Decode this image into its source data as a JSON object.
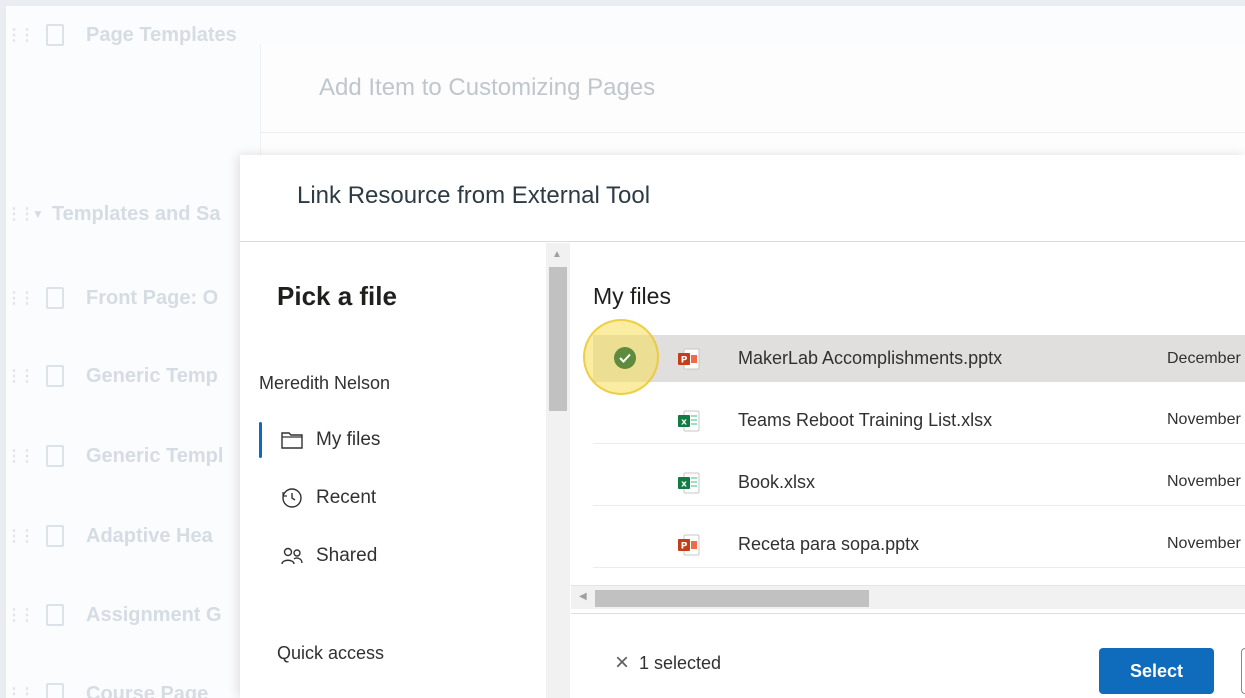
{
  "background": {
    "rows": [
      {
        "label": "Page Templates",
        "kind": "doc"
      },
      {
        "label": "Templates and Sa",
        "kind": "group"
      },
      {
        "label": "Front Page: O",
        "kind": "doc"
      },
      {
        "label": "Generic Temp",
        "kind": "doc"
      },
      {
        "label": "Generic Templ",
        "kind": "doc"
      },
      {
        "label": "Adaptive Hea",
        "kind": "doc"
      },
      {
        "label": "Assignment G",
        "kind": "doc"
      },
      {
        "label": "Course Page",
        "kind": "doc"
      }
    ]
  },
  "middle_modal": {
    "title": "Add Item to Customizing Pages"
  },
  "front_modal": {
    "title": "Link Resource from External Tool"
  },
  "picker": {
    "title": "Pick a file",
    "user": "Meredith Nelson",
    "nav": [
      {
        "label": "My files",
        "icon": "folder-icon",
        "active": true
      },
      {
        "label": "Recent",
        "icon": "history-icon",
        "active": false
      },
      {
        "label": "Shared",
        "icon": "people-icon",
        "active": false
      }
    ],
    "quick_access": "Quick access"
  },
  "files": {
    "title": "My files",
    "rows": [
      {
        "name": "MakerLab Accomplishments.pptx",
        "date": "December",
        "type": "pptx",
        "selected": true
      },
      {
        "name": "Teams Reboot Training List.xlsx",
        "date": "November",
        "type": "xlsx",
        "selected": false
      },
      {
        "name": "Book.xlsx",
        "date": "November",
        "type": "xlsx",
        "selected": false
      },
      {
        "name": "Receta para sopa.pptx",
        "date": "November",
        "type": "pptx",
        "selected": false
      }
    ]
  },
  "footer": {
    "selected_count": "1 selected",
    "select_label": "Select"
  },
  "colors": {
    "accent": "#0f6cbd",
    "pptx": "#c43e1c",
    "xlsx": "#107c41",
    "check": "#5f8b3c",
    "highlight": "#f5dd54"
  }
}
